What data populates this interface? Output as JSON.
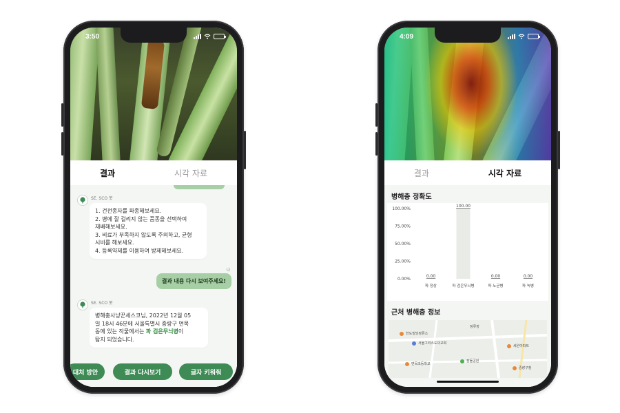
{
  "left_phone": {
    "status_time": "3:50",
    "tabs": {
      "result": "결과",
      "visual": "시각 자료"
    },
    "chat": {
      "bot_name": "SE. SCO 봇",
      "bot_message_1": [
        "1. 건전종자를 파종해보세요.",
        "2. 병에 잘 걸리지 않는 품종을 선택하여",
        "재배해보세요.",
        "3. 비료가 부족하지 않도록 주의하고, 균형",
        "시비를 해보세요.",
        "4. 등록약제를 이용하여 방제해보세요."
      ],
      "user_name": "나",
      "user_message": "결과 내용 다시 보여주세요!",
      "bot_message_2": [
        "병해충사냥꾼세스코님, 2022년 12월 05",
        "일 18시 46분에 서울특별시 중랑구 면목",
        "동에 있는 작물에서는 "
      ],
      "bot_message_2_highlight": "파 검은무늬병",
      "bot_message_2_end_a": "이",
      "bot_message_2_end_b": "탐지 되었습니다."
    },
    "actions": [
      "대처 방안",
      "결과 다시보기",
      "글자 키워줘"
    ]
  },
  "right_phone": {
    "status_time": "4:09",
    "tabs": {
      "result": "결과",
      "visual": "시각 자료"
    },
    "accuracy_title": "병해충 정확도",
    "nearby_title": "근처 병해충 정보",
    "map_labels": {
      "place1": "한도빌딩정류소",
      "place2": "서울그리스도의교회",
      "place3": "면목초등학교",
      "place4": "장돌공원",
      "place5": "세원아파트",
      "place6": "정류장",
      "place7": "중랑구청"
    }
  },
  "chart_data": {
    "type": "bar",
    "title": "병해충 정확도",
    "categories": [
      "파 정상",
      "파 검은무늬병",
      "파 노균병",
      "파 녹병"
    ],
    "values": [
      0.0,
      100.0,
      0.0,
      0.0
    ],
    "value_labels": [
      "0.00",
      "100.00",
      "0.00",
      "0.00"
    ],
    "yticks": [
      "100.00%",
      "75.00%",
      "50.00%",
      "25.00%",
      "0.00%"
    ],
    "ylim": [
      0,
      100
    ],
    "grid": false,
    "bar_color": "#e9ebe7"
  },
  "colors": {
    "accent": "#3f8b55",
    "user_bubble": "#a7cfa5",
    "highlight": "#2e8b3e"
  }
}
